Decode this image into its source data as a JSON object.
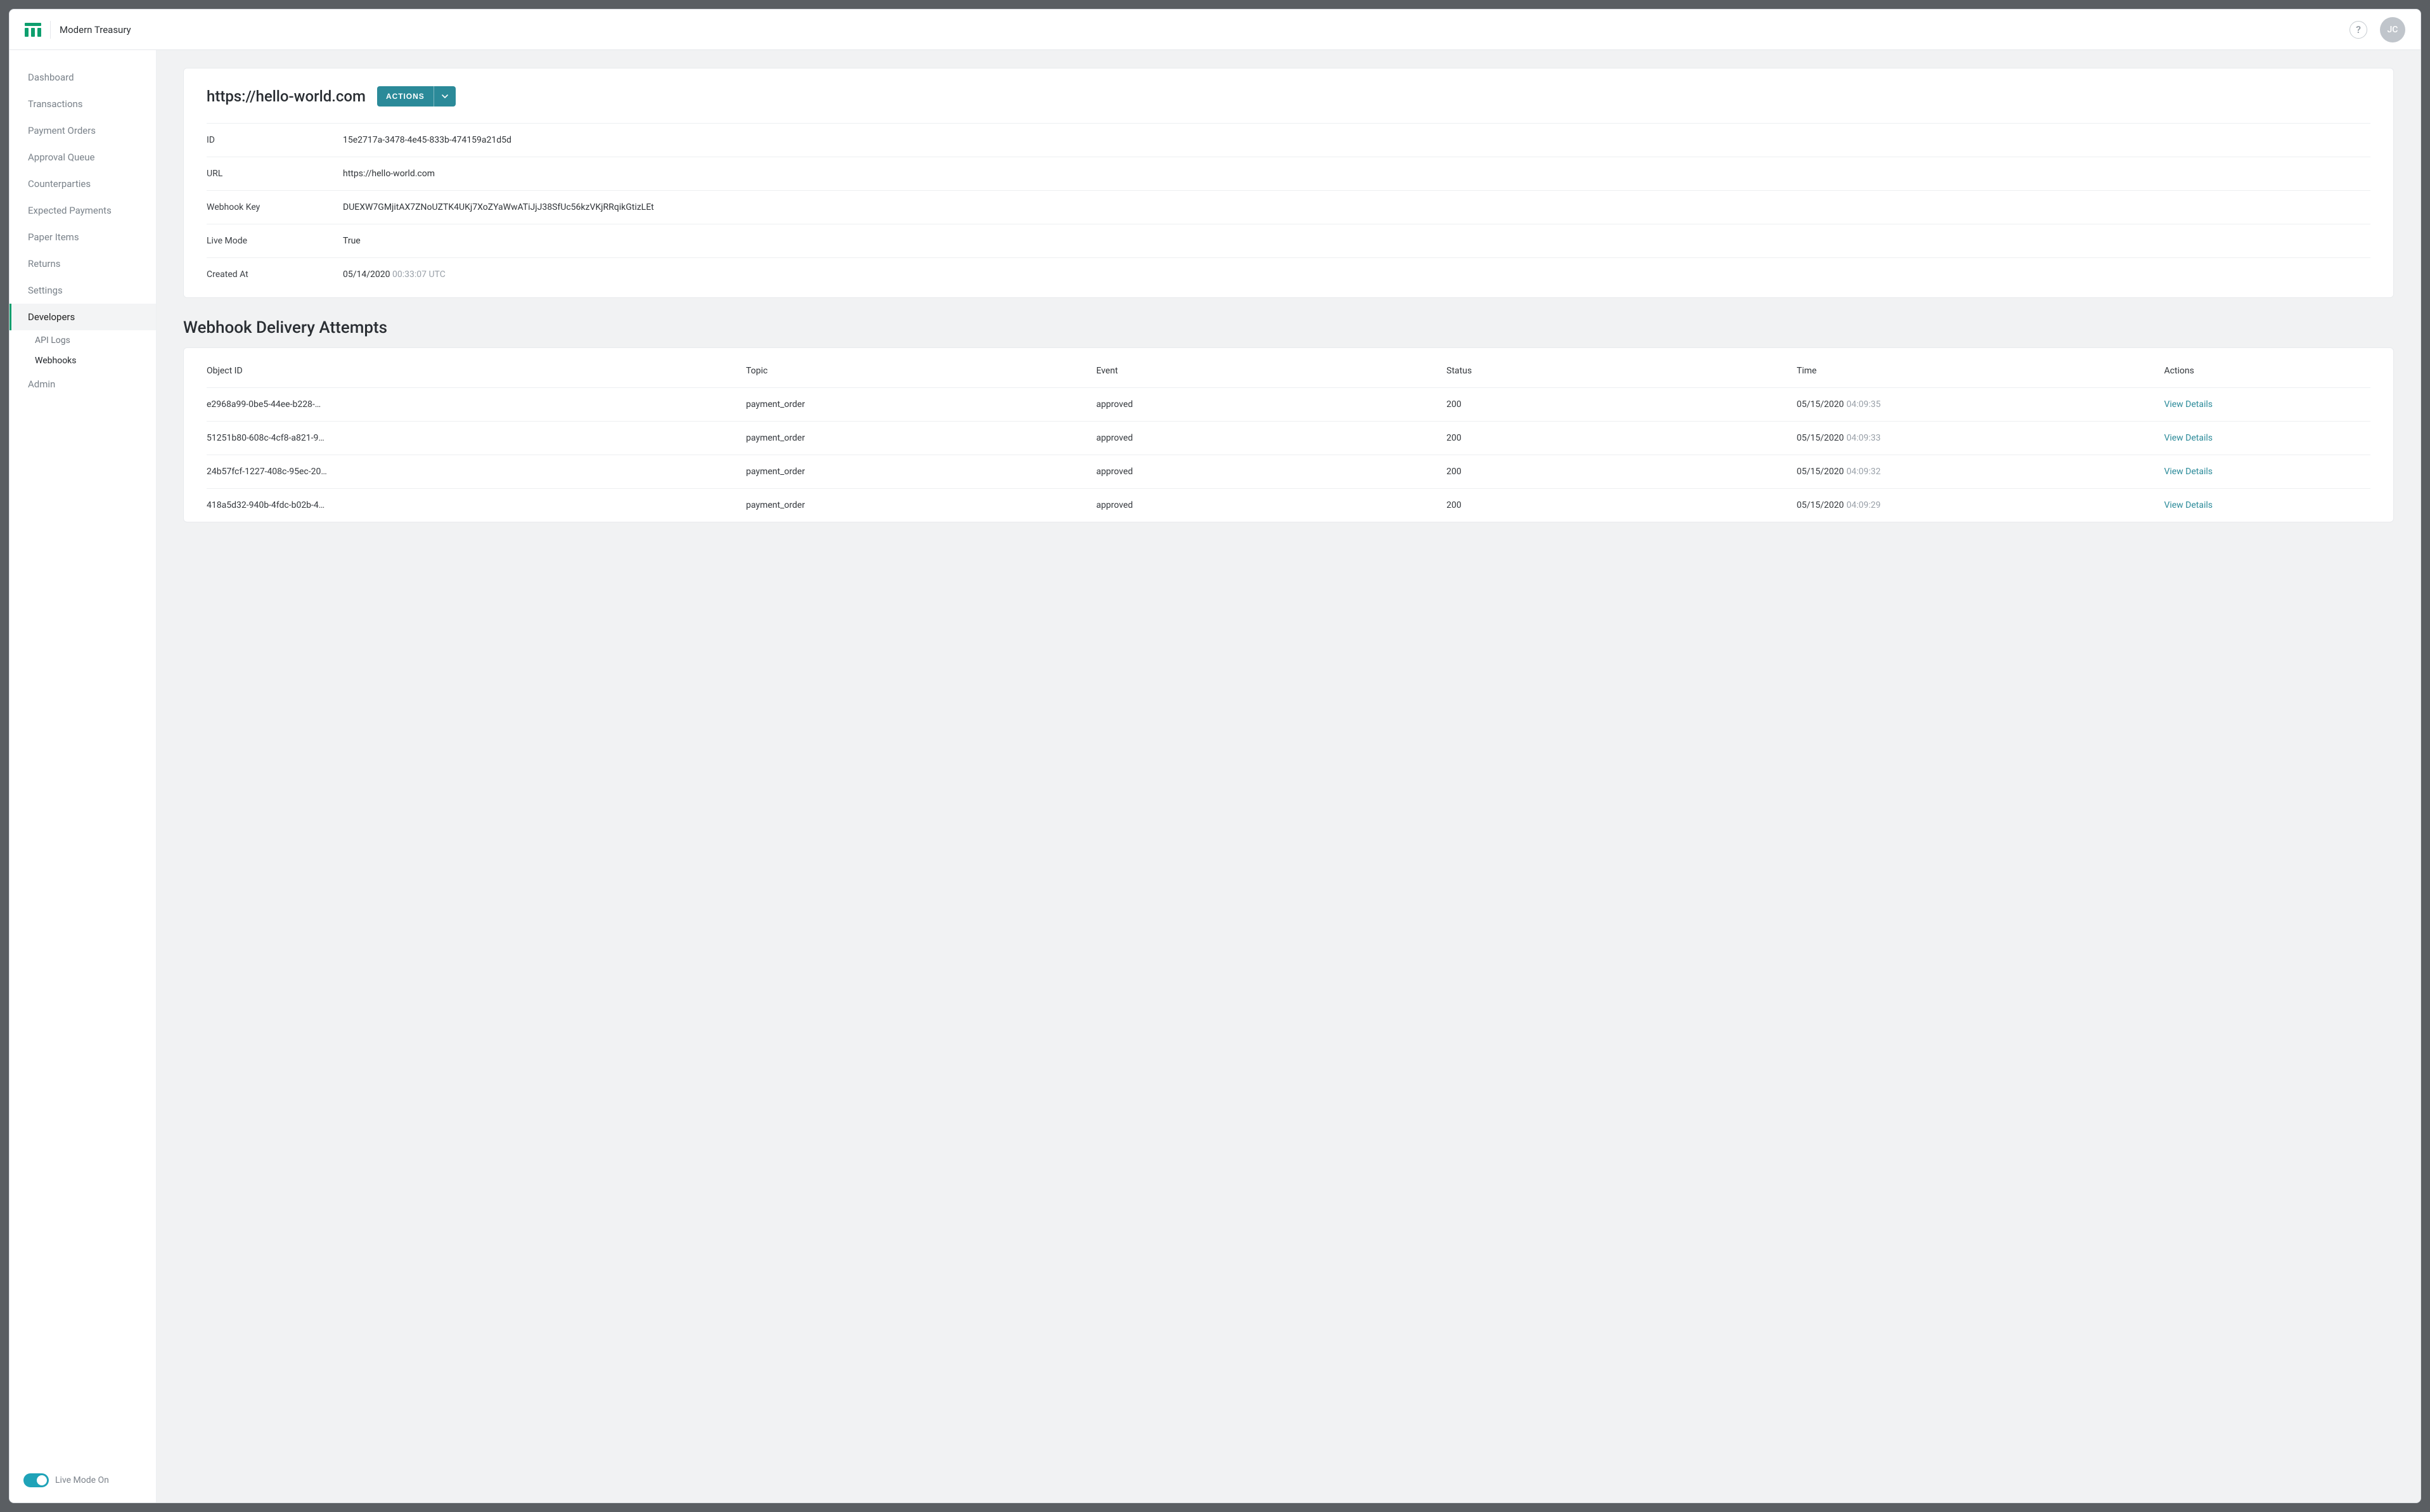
{
  "brand": "Modern Treasury",
  "avatar_initials": "JC",
  "sidebar": {
    "items": [
      {
        "label": "Dashboard"
      },
      {
        "label": "Transactions"
      },
      {
        "label": "Payment Orders"
      },
      {
        "label": "Approval Queue"
      },
      {
        "label": "Counterparties"
      },
      {
        "label": "Expected Payments"
      },
      {
        "label": "Paper Items"
      },
      {
        "label": "Returns"
      },
      {
        "label": "Settings"
      },
      {
        "label": "Developers"
      },
      {
        "label": "Admin"
      }
    ],
    "sub_items": [
      {
        "label": "API Logs"
      },
      {
        "label": "Webhooks"
      }
    ],
    "live_mode_label": "Live Mode On"
  },
  "page": {
    "title": "https://hello-world.com",
    "actions_label": "ACTIONS"
  },
  "details": {
    "id_label": "ID",
    "id_value": "15e2717a-3478-4e45-833b-474159a21d5d",
    "url_label": "URL",
    "url_value": "https://hello-world.com",
    "key_label": "Webhook Key",
    "key_value": "DUEXW7GMjitAX7ZNoUZTK4UKj7XoZYaWwATiJjJ38SfUc56kzVKjRRqikGtizLEt",
    "mode_label": "Live Mode",
    "mode_value": "True",
    "created_label": "Created At",
    "created_date": "05/14/2020",
    "created_time": "00:33:07 UTC"
  },
  "section_title": "Webhook Delivery Attempts",
  "table": {
    "headers": {
      "object_id": "Object ID",
      "topic": "Topic",
      "event": "Event",
      "status": "Status",
      "time": "Time",
      "actions": "Actions"
    },
    "view_details_label": "View Details",
    "rows": [
      {
        "object_id": "e2968a99-0be5-44ee-b228-…",
        "topic": "payment_order",
        "event": "approved",
        "status": "200",
        "date": "05/15/2020",
        "time": "04:09:35"
      },
      {
        "object_id": "51251b80-608c-4cf8-a821-9…",
        "topic": "payment_order",
        "event": "approved",
        "status": "200",
        "date": "05/15/2020",
        "time": "04:09:33"
      },
      {
        "object_id": "24b57fcf-1227-408c-95ec-20…",
        "topic": "payment_order",
        "event": "approved",
        "status": "200",
        "date": "05/15/2020",
        "time": "04:09:32"
      },
      {
        "object_id": "418a5d32-940b-4fdc-b02b-4…",
        "topic": "payment_order",
        "event": "approved",
        "status": "200",
        "date": "05/15/2020",
        "time": "04:09:29"
      }
    ]
  }
}
